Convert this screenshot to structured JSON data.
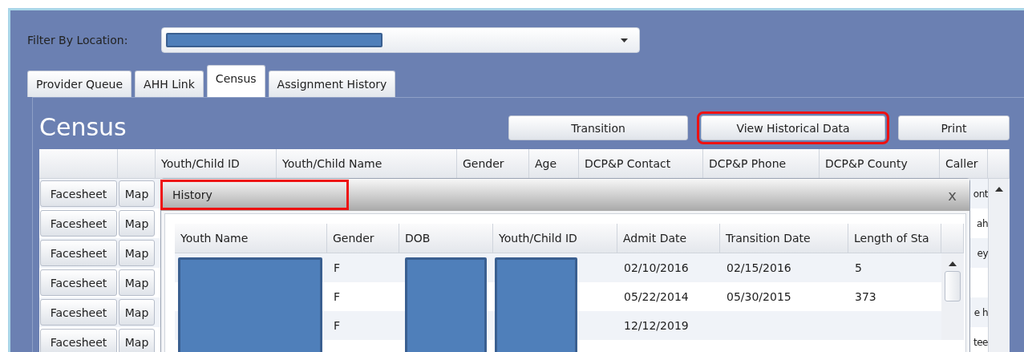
{
  "filter": {
    "label": "Filter By Location:"
  },
  "tabs": [
    {
      "label": "Provider Queue",
      "selected": false
    },
    {
      "label": "AHH Link",
      "selected": false
    },
    {
      "label": "Census",
      "selected": true
    },
    {
      "label": "Assignment History",
      "selected": false
    }
  ],
  "panel": {
    "title": "Census",
    "buttons": [
      {
        "label": "Transition",
        "highlighted": false
      },
      {
        "label": "View Historical Data",
        "highlighted": true
      },
      {
        "label": "Print",
        "highlighted": false
      }
    ]
  },
  "census_table": {
    "columns": [
      "Youth/Child ID",
      "Youth/Child Name",
      "Gender",
      "Age",
      "DCP&P Contact",
      "DCP&P Phone",
      "DCP&P County",
      "Caller"
    ],
    "rows": [
      {
        "facesheet": "Facesheet",
        "map": "Map",
        "caller": "ont"
      },
      {
        "facesheet": "Facesheet",
        "map": "Map",
        "caller": "ah"
      },
      {
        "facesheet": "Facesheet",
        "map": "Map",
        "caller": "ey"
      },
      {
        "facesheet": "Facesheet",
        "map": "Map"
      },
      {
        "facesheet": "Facesheet",
        "map": "Map",
        "caller": "e h"
      },
      {
        "facesheet": "Facesheet",
        "map": "Map",
        "caller": "tee"
      }
    ]
  },
  "dialog": {
    "title": "History",
    "title_highlighted": true,
    "close": "x",
    "columns": [
      "Youth Name",
      "Gender",
      "DOB",
      "Youth/Child ID",
      "Admit Date",
      "Transition Date",
      "Length of Sta"
    ],
    "rows": [
      {
        "gender": "F",
        "admit_date": "02/10/2016",
        "transition_date": "02/15/2016",
        "length_of_stay": "5"
      },
      {
        "gender": "F",
        "admit_date": "05/22/2014",
        "transition_date": "05/30/2015",
        "length_of_stay": "373"
      },
      {
        "gender": "F",
        "admit_date": "12/12/2019"
      }
    ]
  }
}
